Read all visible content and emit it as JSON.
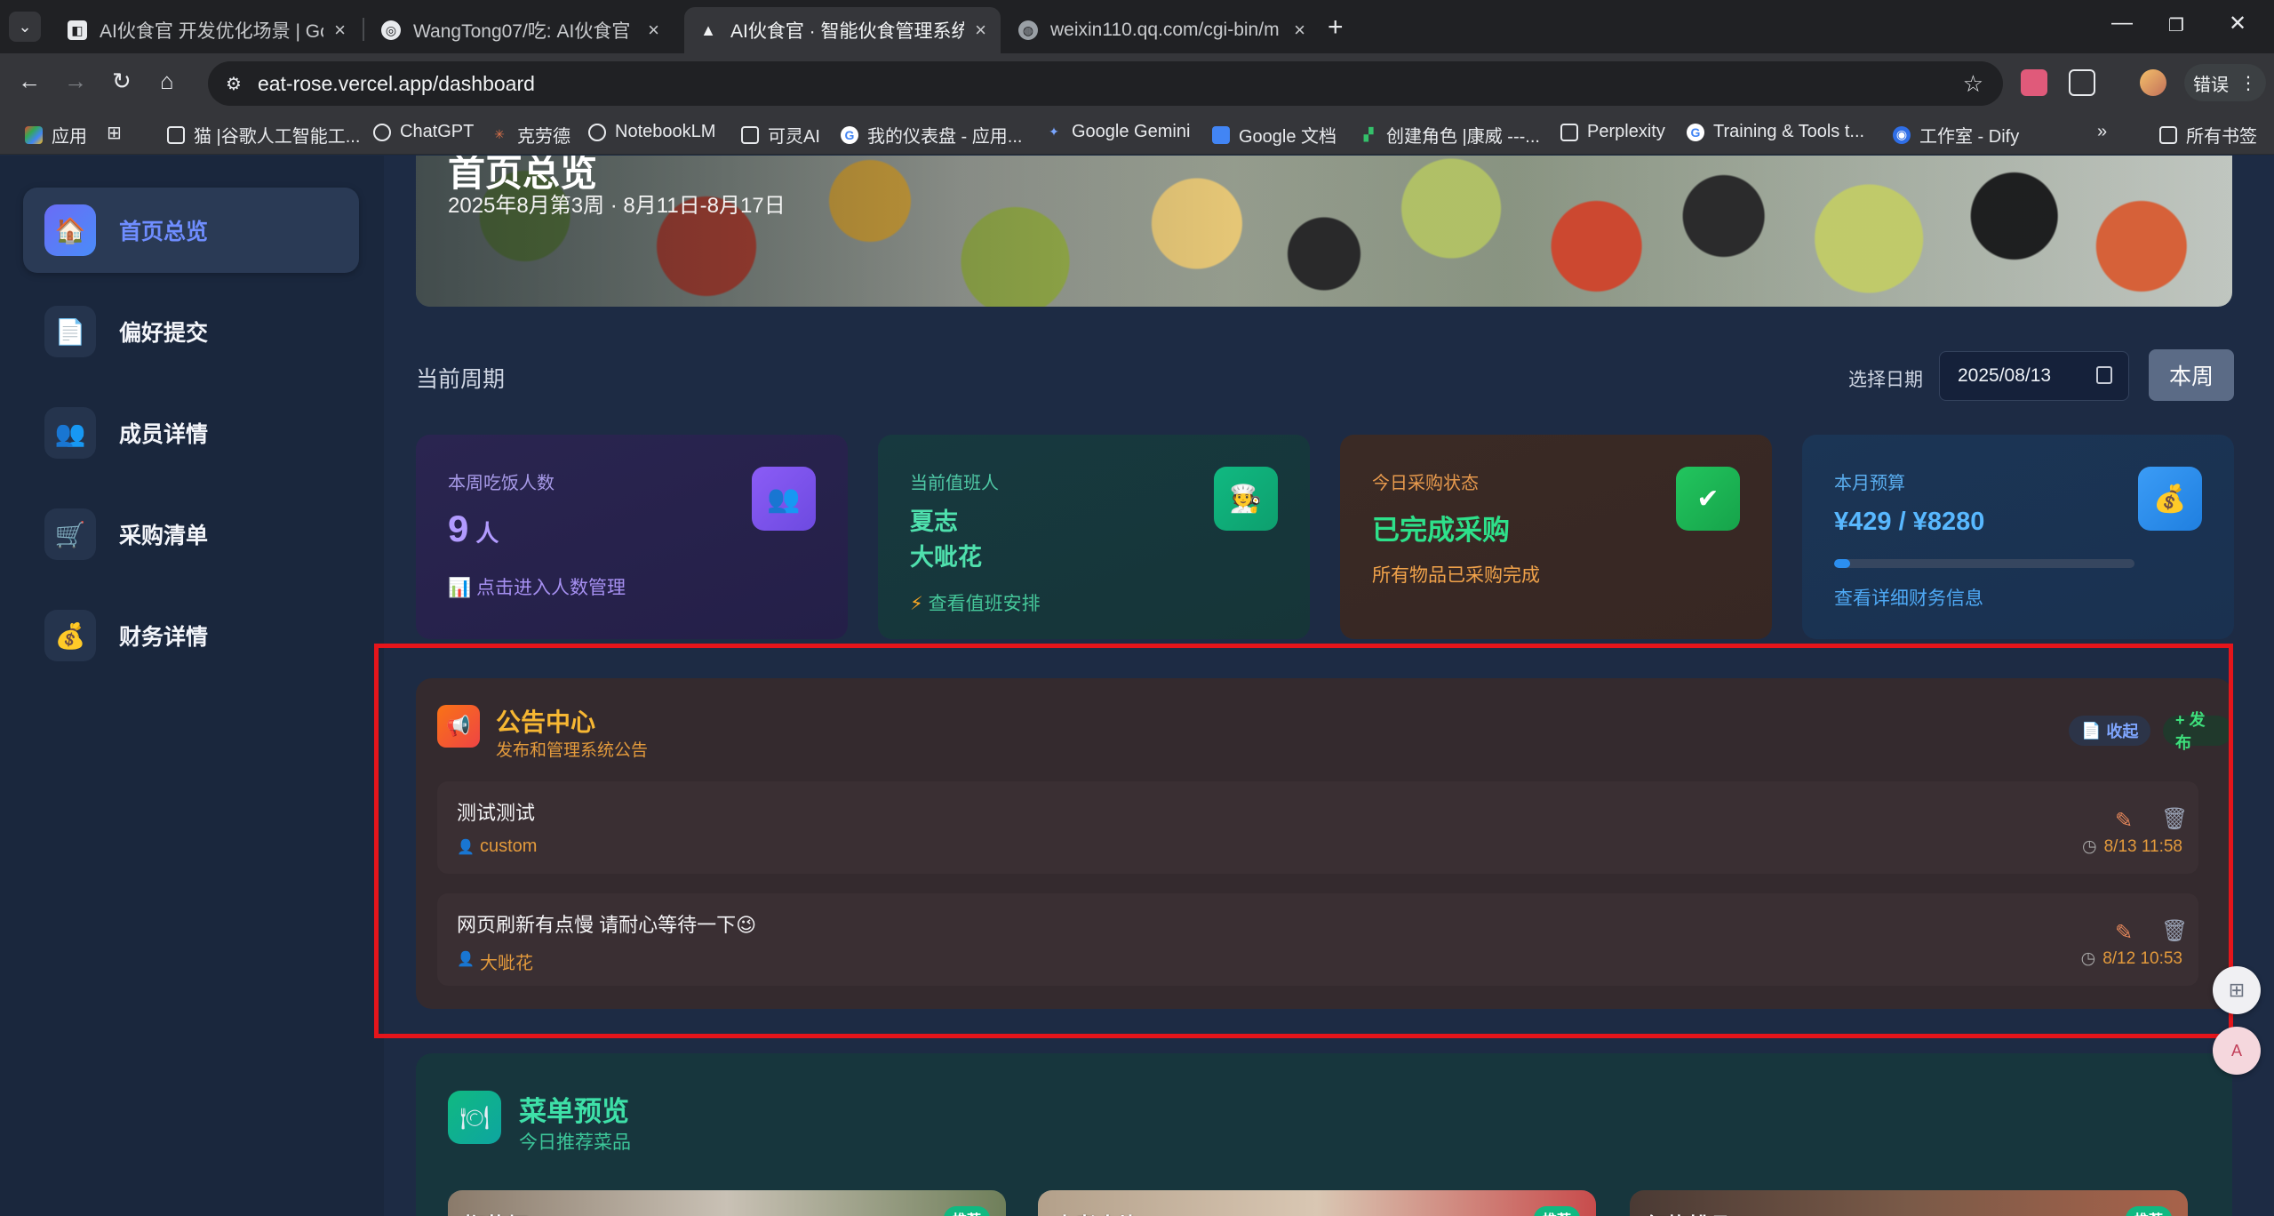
{
  "browser": {
    "tabs": [
      {
        "title": "AI伙食官 开发优化场景 | Goog",
        "active": false
      },
      {
        "title": "WangTong07/吃: AI伙食官",
        "active": false
      },
      {
        "title": "AI伙食官 · 智能伙食管理系统",
        "active": true
      },
      {
        "title": "weixin110.qq.com/cgi-bin/m",
        "active": false
      }
    ],
    "url": "eat-rose.vercel.app/dashboard",
    "profile_label": "错误",
    "bookmarks": [
      "应用",
      "猫 |谷歌人工智能工...",
      "ChatGPT",
      "克劳德",
      "NotebookLM",
      "可灵AI",
      "我的仪表盘 - 应用...",
      "Google Gemini",
      "Google 文档",
      "创建角色 |康威 ---...",
      "Perplexity",
      "Training & Tools t...",
      "工作室 - Dify",
      "所有书签"
    ]
  },
  "sidebar": {
    "items": [
      {
        "label": "首页总览",
        "icon": "home-icon",
        "active": true
      },
      {
        "label": "偏好提交",
        "icon": "document-icon",
        "active": false
      },
      {
        "label": "成员详情",
        "icon": "people-icon",
        "active": false
      },
      {
        "label": "采购清单",
        "icon": "cart-icon",
        "active": false
      },
      {
        "label": "财务详情",
        "icon": "money-bag-icon",
        "active": false
      }
    ]
  },
  "hero": {
    "title": "首页总览",
    "subtitle": "2025年8月第3周 · 8月11日-8月17日"
  },
  "period": {
    "label": "当前周期",
    "date_label": "选择日期",
    "date_value": "2025/08/13",
    "week_button": "本周"
  },
  "cards": {
    "diners": {
      "label": "本周吃饭人数",
      "value": "9",
      "unit": "人",
      "link": "点击进入人数管理"
    },
    "duty": {
      "label": "当前值班人",
      "people": [
        "夏志",
        "大呲花"
      ],
      "link": "查看值班安排"
    },
    "purchase": {
      "label": "今日采购状态",
      "status": "已完成采购",
      "sub": "所有物品已采购完成"
    },
    "budget": {
      "label": "本月预算",
      "value": "¥429 / ¥8280",
      "progress": 0.052,
      "link": "查看详细财务信息"
    }
  },
  "announcements": {
    "title": "公告中心",
    "subtitle": "发布和管理系统公告",
    "collapse_label": "收起",
    "publish_label": "+ 发布",
    "items": [
      {
        "title": "测试测试",
        "author": "custom",
        "time": "8/13 11:58"
      },
      {
        "title": "网页刷新有点慢 请耐心等待一下😉",
        "author": "大呲花",
        "time": "8/12 10:53"
      }
    ]
  },
  "menu": {
    "title": "菜单预览",
    "subtitle": "今日推荐菜品",
    "dishes": [
      {
        "name": "椒盐虾",
        "badge": "推荐"
      },
      {
        "name": "水煮肉片",
        "badge": "推荐"
      },
      {
        "name": "红烧排骨",
        "badge": "推荐"
      }
    ]
  },
  "colors": {
    "highlight_box": "#e5151b",
    "accent_purple": "#8b5cf6",
    "accent_green": "#10b981",
    "accent_blue": "#3b9cf6",
    "accent_orange": "#f7b733"
  }
}
